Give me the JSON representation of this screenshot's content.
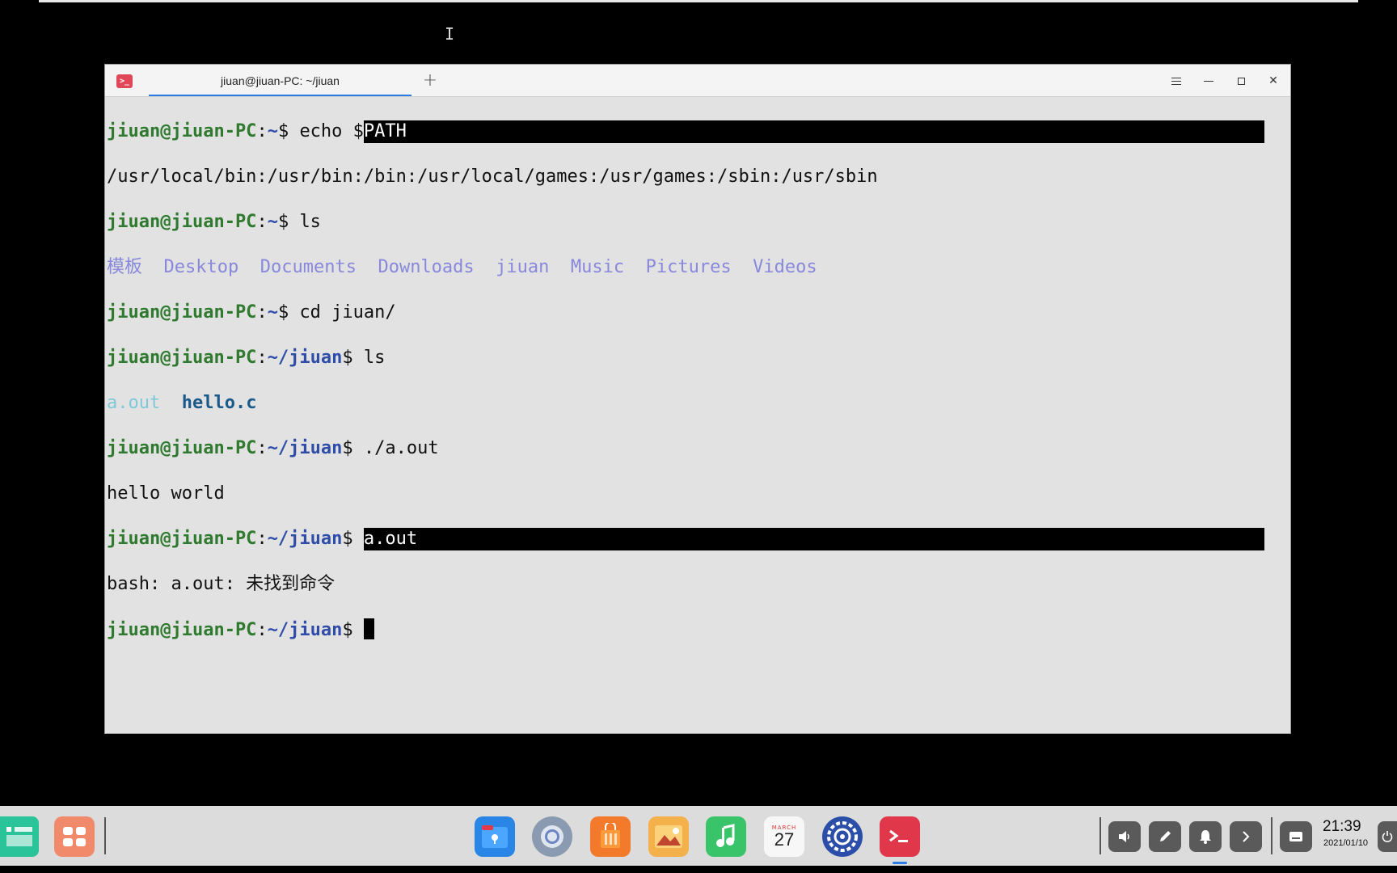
{
  "window": {
    "tab_title": "jiuan@jiuan-PC: ~/jiuan",
    "new_tab_glyph": "+",
    "menu_icon": "menu-icon",
    "minimize_glyph": "–",
    "close_glyph": "✕"
  },
  "terminal": {
    "prompt_user": "jiuan@jiuan-PC",
    "colon": ":",
    "home": "~",
    "home_jiuan": "~/jiuan",
    "dollar": "$ ",
    "cmd1": "echo $",
    "cmd1_selected": "PATH",
    "out1": "/usr/local/bin:/usr/bin:/bin:/usr/local/games:/usr/games:/sbin:/usr/sbin",
    "cmd2": "ls",
    "ls_home": [
      "模板",
      "Desktop",
      "Documents",
      "Downloads",
      "jiuan",
      "Music",
      "Pictures",
      "Videos"
    ],
    "cmd3": "cd jiuan/",
    "cmd4": "ls",
    "ls_jiuan_exe": "a.out",
    "ls_jiuan_src": "hello.c",
    "cmd5": "./a.out",
    "out5": "hello world",
    "cmd6_selected": "a.out",
    "out6": "bash: a.out: 未找到命令"
  },
  "taskbar": {
    "launcher_icon": "multitasking-icon",
    "apps": [
      "file-manager-icon",
      "browser-icon",
      "app-store-icon",
      "image-viewer-icon",
      "music-icon",
      "calendar-icon",
      "control-center-icon",
      "terminal-icon"
    ],
    "calendar_month": "MARCH",
    "calendar_day": "27",
    "tray": [
      "volume-icon",
      "pen-icon",
      "bell-icon",
      "chevron-right-icon",
      "keyboard-icon"
    ],
    "time": "21:39",
    "date": "2021/01/10"
  }
}
